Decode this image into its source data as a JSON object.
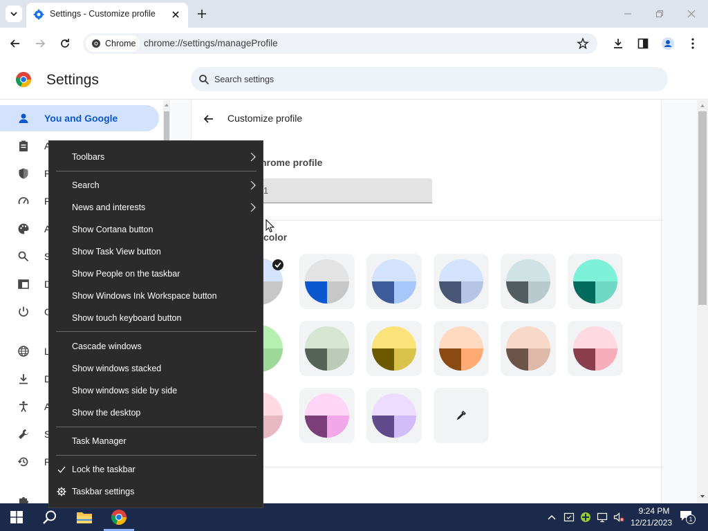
{
  "browser": {
    "tab_title": "Settings - Customize profile",
    "omnibox_chip": "Chrome",
    "url": "chrome://settings/manageProfile"
  },
  "settings": {
    "title": "Settings",
    "search_placeholder": "Search settings",
    "sidebar": {
      "active_item": "You and Google",
      "truncated_letters": [
        "A",
        "P",
        "P",
        "A",
        "S",
        "D",
        "O",
        "L",
        "D",
        "A",
        "S",
        "R"
      ]
    },
    "page": {
      "title": "Customize profile",
      "profile_heading_fragment": "hrome profile",
      "profile_name_fragment": "1",
      "color_heading_fragment": "color"
    },
    "theme_swatches": [
      {
        "top": "#e3e3e3",
        "left": "#0b57d0",
        "right": "#c7c7c7"
      },
      {
        "top": "#d3e3fd",
        "left": "#3d5a9a",
        "right": "#a8c7fa"
      },
      {
        "top": "#d3e3fd",
        "left": "#4a5675",
        "right": "#b6c4e6"
      },
      {
        "top": "#cfe3e4",
        "left": "#535d5f",
        "right": "#b8cacc"
      },
      {
        "top": "#7ef1d9",
        "left": "#006a5d",
        "right": "#6ed8c4"
      },
      {
        "top": "#d7e6d3",
        "left": "#566256",
        "right": "#bccbb9"
      },
      {
        "top": "#fbe37a",
        "left": "#6b5a00",
        "right": "#d8c24a"
      },
      {
        "top": "#ffd9c2",
        "left": "#8c4a13",
        "right": "#ffac74"
      },
      {
        "top": "#f8d8c8",
        "left": "#6e5448",
        "right": "#deb9a8"
      },
      {
        "top": "#ffd9e2",
        "left": "#8a3e4d",
        "right": "#f8adbd"
      },
      {
        "top": "#ffd6f7",
        "left": "#7c3e78",
        "right": "#f2a7e8"
      },
      {
        "top": "#ecdcff",
        "left": "#5f4a8c",
        "right": "#d2bcfa"
      }
    ]
  },
  "context_menu": {
    "items": [
      {
        "label": "Toolbars",
        "submenu": true
      },
      {
        "label": "Search",
        "submenu": true
      },
      {
        "label": "News and interests",
        "submenu": true
      },
      {
        "label": "Show Cortana button"
      },
      {
        "label": "Show Task View button"
      },
      {
        "label": "Show People on the taskbar"
      },
      {
        "label": "Show Windows Ink Workspace button"
      },
      {
        "label": "Show touch keyboard button"
      },
      {
        "label": "Cascade windows"
      },
      {
        "label": "Show windows stacked"
      },
      {
        "label": "Show windows side by side"
      },
      {
        "label": "Show the desktop"
      },
      {
        "label": "Task Manager"
      },
      {
        "label": "Lock the taskbar",
        "checked": true
      },
      {
        "label": "Taskbar settings",
        "icon": "gear-icon"
      }
    ]
  },
  "taskbar": {
    "time": "9:24 PM",
    "date": "12/21/2023",
    "notification_count": "1"
  }
}
